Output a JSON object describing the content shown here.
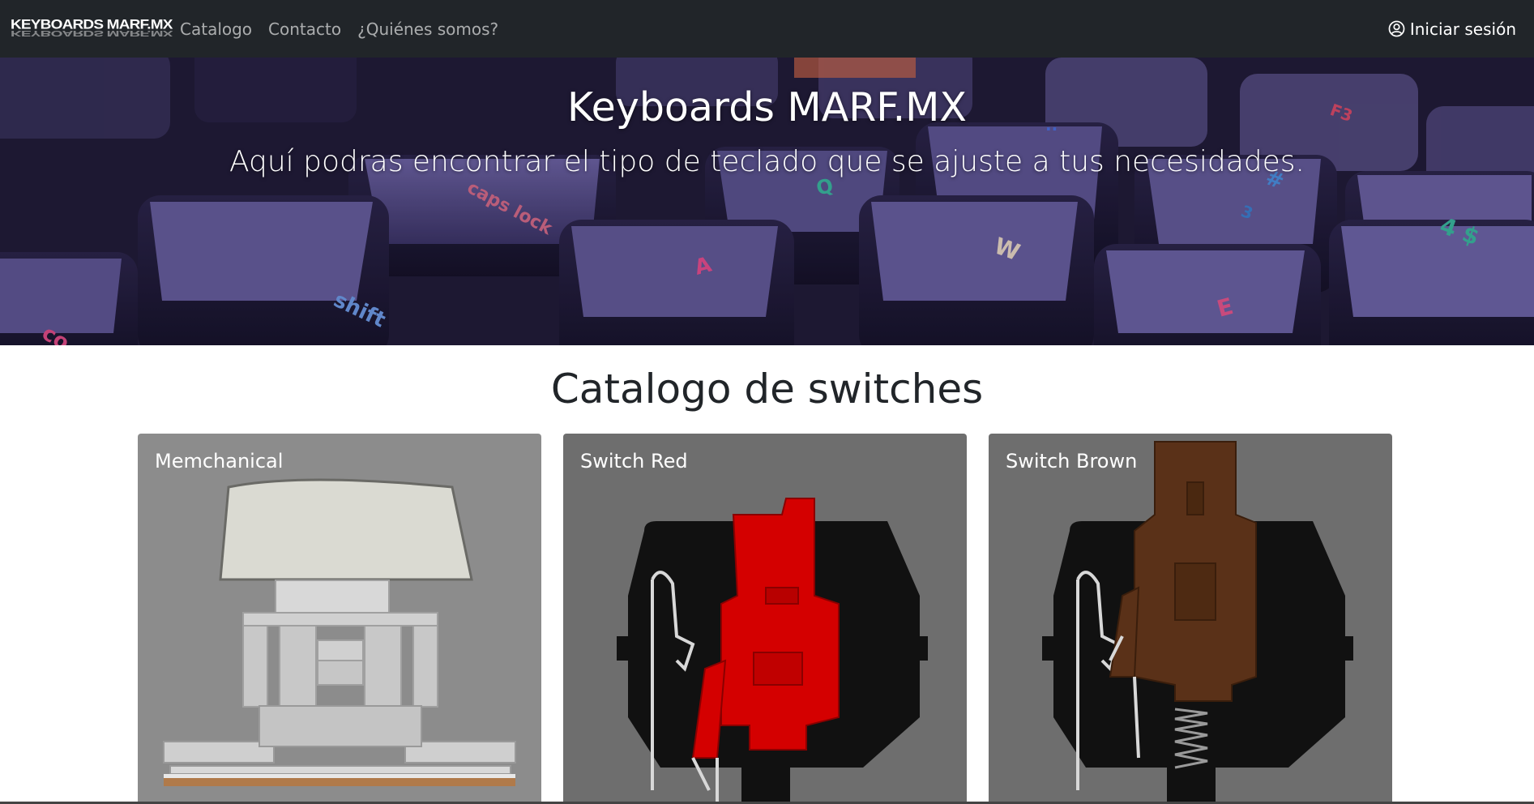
{
  "navbar": {
    "brand": "KEYBOARDS MARF.MX",
    "links": [
      "Catalogo",
      "Contacto",
      "¿Quiénes somos?"
    ],
    "login_label": "Iniciar sesión"
  },
  "hero": {
    "title": "Keyboards MARF.MX",
    "subtitle": "Aquí podras encontrar el tipo de teclado que se ajuste a tus necesidades."
  },
  "catalog": {
    "title": "Catalogo de switches",
    "cards": [
      {
        "title": "Memchanical",
        "bg": "#8c8c8c"
      },
      {
        "title": "Switch Red",
        "bg": "#6e6e6e",
        "stem_color": "#d40000"
      },
      {
        "title": "Switch Brown",
        "bg": "#6e6e6e",
        "stem_color": "#5a3118"
      }
    ]
  },
  "colors": {
    "navbar_bg": "#212529",
    "accent_text": "#ffffff"
  }
}
